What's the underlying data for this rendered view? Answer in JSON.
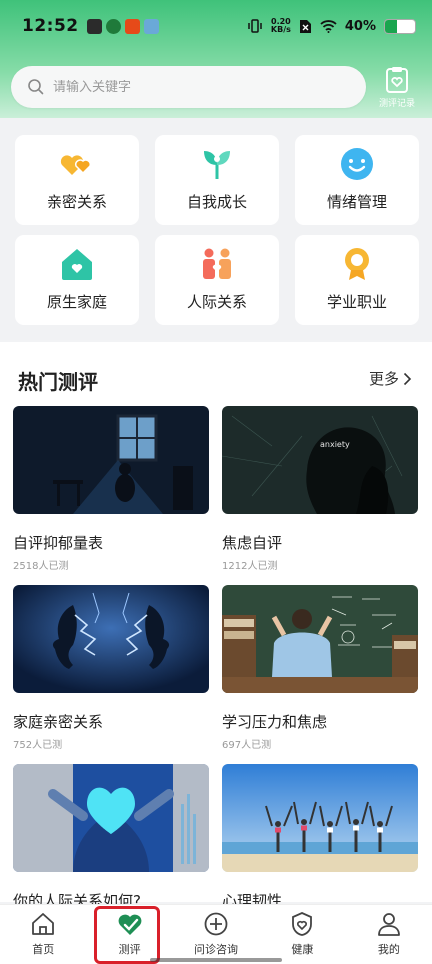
{
  "status_bar": {
    "time": "12:52",
    "speed_top": "0.20",
    "speed_bottom": "KB/s",
    "battery": "40%",
    "battery_level": 0.4
  },
  "search": {
    "placeholder": "请输入关键字"
  },
  "record": {
    "label": "测评记录"
  },
  "categories": [
    {
      "label": "亲密关系",
      "icon": "hearts-icon"
    },
    {
      "label": "自我成长",
      "icon": "sprout-icon"
    },
    {
      "label": "情绪管理",
      "icon": "smile-icon"
    },
    {
      "label": "原生家庭",
      "icon": "home-heart-icon"
    },
    {
      "label": "人际关系",
      "icon": "people-icon"
    },
    {
      "label": "学业职业",
      "icon": "medal-icon"
    }
  ],
  "hot": {
    "title": "热门测评",
    "more": "更多"
  },
  "quizzes": [
    {
      "title": "自评抑郁量表",
      "count": "2518人已测"
    },
    {
      "title": "焦虑自评",
      "count": "1212人已测",
      "image_text": "anxiety"
    },
    {
      "title": "家庭亲密关系",
      "count": "752人已测"
    },
    {
      "title": "学习压力和焦虑",
      "count": "697人已测"
    },
    {
      "title": "你的人际关系如何?",
      "count": ""
    },
    {
      "title": "心理韧性",
      "count": ""
    }
  ],
  "nav": [
    {
      "label": "首页",
      "icon": "home-icon"
    },
    {
      "label": "测评",
      "icon": "heart-check-icon"
    },
    {
      "label": "问诊咨询",
      "icon": "plus-circle-icon"
    },
    {
      "label": "健康",
      "icon": "shield-heart-icon"
    },
    {
      "label": "我的",
      "icon": "user-icon"
    }
  ],
  "colors": {
    "brand_green": "#3fc27a",
    "active_highlight": "#d9202a"
  }
}
